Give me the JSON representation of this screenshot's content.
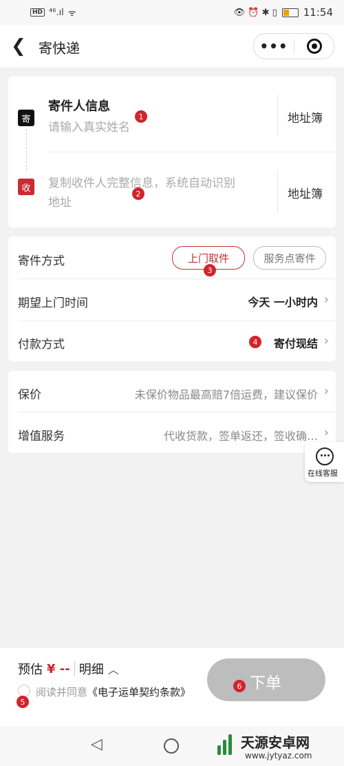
{
  "status_bar": {
    "net": "HD",
    "signal": "⁴⁶.ıl",
    "wifi": "ᯤ",
    "icons": "👁 ⏰ ✱ ▯",
    "time": "11:54"
  },
  "nav": {
    "title": "寄快递",
    "more_glyph": "•••"
  },
  "sender": {
    "badge": "寄",
    "title": "寄件人信息",
    "placeholder": "请输入真实姓名",
    "address_book": "地址簿",
    "marker": "1"
  },
  "receiver": {
    "badge": "收",
    "placeholder_line1": "复制收件人完整信息，系统自动识别",
    "placeholder_line2": "地址",
    "address_book": "地址簿",
    "marker": "2"
  },
  "method": {
    "label": "寄件方式",
    "option1": "上门取件",
    "option2": "服务点寄件",
    "marker": "3"
  },
  "pickup_time": {
    "label": "期望上门时间",
    "value": "今天 一小时内"
  },
  "payment": {
    "label": "付款方式",
    "value": "寄付现结",
    "marker": "4"
  },
  "insurance": {
    "label": "保价",
    "value": "未保价物品最高赔7倍运费，建议保价"
  },
  "addons": {
    "label": "增值服务",
    "value": "代收货款，签单返还，签收确…"
  },
  "service": {
    "label": "在线客服"
  },
  "footer": {
    "estimate_label": "预估",
    "price": "¥ --",
    "detail": "明细",
    "agree_text": "阅读并同意",
    "terms": "《电子运单契约条款》",
    "submit": "下单",
    "marker5": "5",
    "marker6": "6"
  },
  "watermark": {
    "brand": "天源安卓网",
    "url": "www.jytyaz.com"
  },
  "colors": {
    "accent": "#d2242c",
    "submit_bg": "#bdbdbd"
  }
}
